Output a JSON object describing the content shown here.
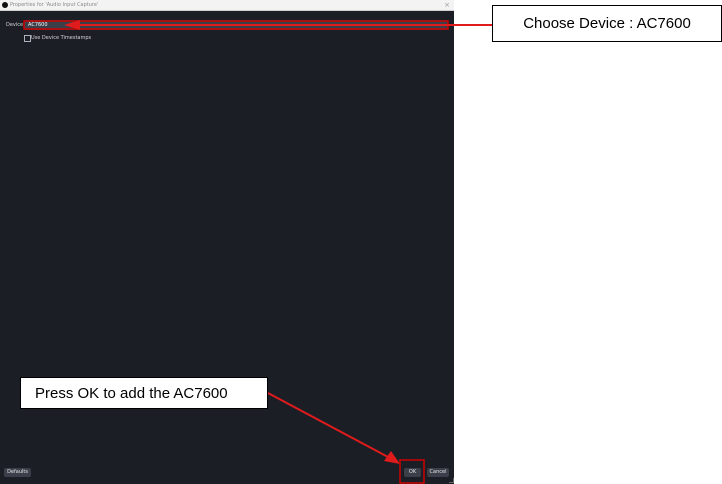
{
  "window": {
    "title": "Properties for 'Audio Input Capture'",
    "close_icon": "×"
  },
  "form": {
    "device_label": "Device",
    "device_value": "AC7600",
    "chevron": "⌄",
    "use_timestamps_label": "Use Device Timestamps",
    "use_timestamps_checked": false
  },
  "buttons": {
    "defaults": "Defaults",
    "ok": "OK",
    "cancel": "Cancel"
  },
  "annotations": {
    "device_callout": "Choose Device : AC7600",
    "ok_callout": "Press OK to add the AC7600",
    "arrow_color": "#e01b1b",
    "highlight_color": "#cc0000"
  }
}
